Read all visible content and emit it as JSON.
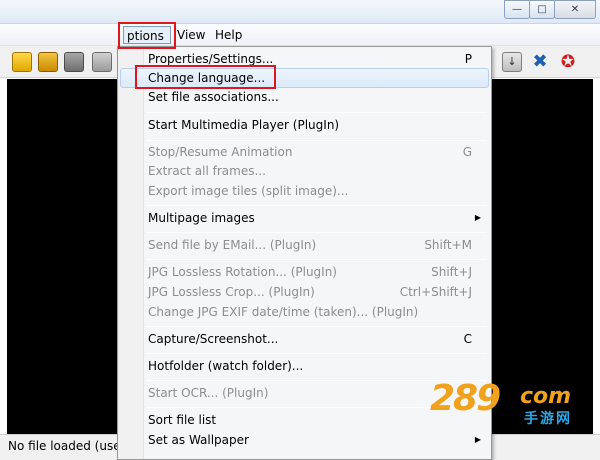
{
  "menubar": {
    "items": [
      {
        "label": "ptions"
      },
      {
        "label": "View"
      },
      {
        "label": "Help"
      }
    ]
  },
  "status": {
    "text": "No file loaded (use I"
  },
  "dropdown": {
    "items": [
      {
        "label": "Properties/Settings...",
        "shortcut": "P"
      },
      {
        "label": "Change language...",
        "shortcut": ""
      },
      {
        "label": "Set file associations...",
        "shortcut": ""
      },
      {
        "label": "Start Multimedia Player (PlugIn)",
        "shortcut": ""
      },
      {
        "label": "Stop/Resume Animation",
        "shortcut": "G"
      },
      {
        "label": "Extract all frames...",
        "shortcut": ""
      },
      {
        "label": "Export image tiles (split image)...",
        "shortcut": ""
      },
      {
        "label": "Multipage images",
        "shortcut": ""
      },
      {
        "label": "Send file by EMail... (PlugIn)",
        "shortcut": "Shift+M"
      },
      {
        "label": "JPG Lossless Rotation... (PlugIn)",
        "shortcut": "Shift+J"
      },
      {
        "label": "JPG Lossless Crop... (PlugIn)",
        "shortcut": "Ctrl+Shift+J"
      },
      {
        "label": "Change JPG EXIF date/time (taken)... (PlugIn)",
        "shortcut": ""
      },
      {
        "label": "Capture/Screenshot...",
        "shortcut": "C"
      },
      {
        "label": "Hotfolder (watch folder)...",
        "shortcut": ""
      },
      {
        "label": "Start OCR... (PlugIn)",
        "shortcut": ""
      },
      {
        "label": "Sort file list",
        "shortcut": ""
      },
      {
        "label": "Set as Wallpaper",
        "shortcut": ""
      }
    ]
  },
  "watermark": {
    "number": "289",
    "com": "com",
    "cn": "手游网"
  },
  "icons": {
    "toolbar": [
      "folder-open-icon",
      "folder-browse-icon",
      "save-icon",
      "print-icon",
      "download-icon",
      "tools-icon",
      "plugin-icon"
    ],
    "window": [
      "minimize-icon",
      "maximize-icon",
      "close-icon"
    ]
  },
  "colors": {
    "highlight_box": "#e0161e",
    "viewer_background": "#000000",
    "watermark_orange": "#f0a21d",
    "watermark_blue": "#2ea8e6"
  }
}
